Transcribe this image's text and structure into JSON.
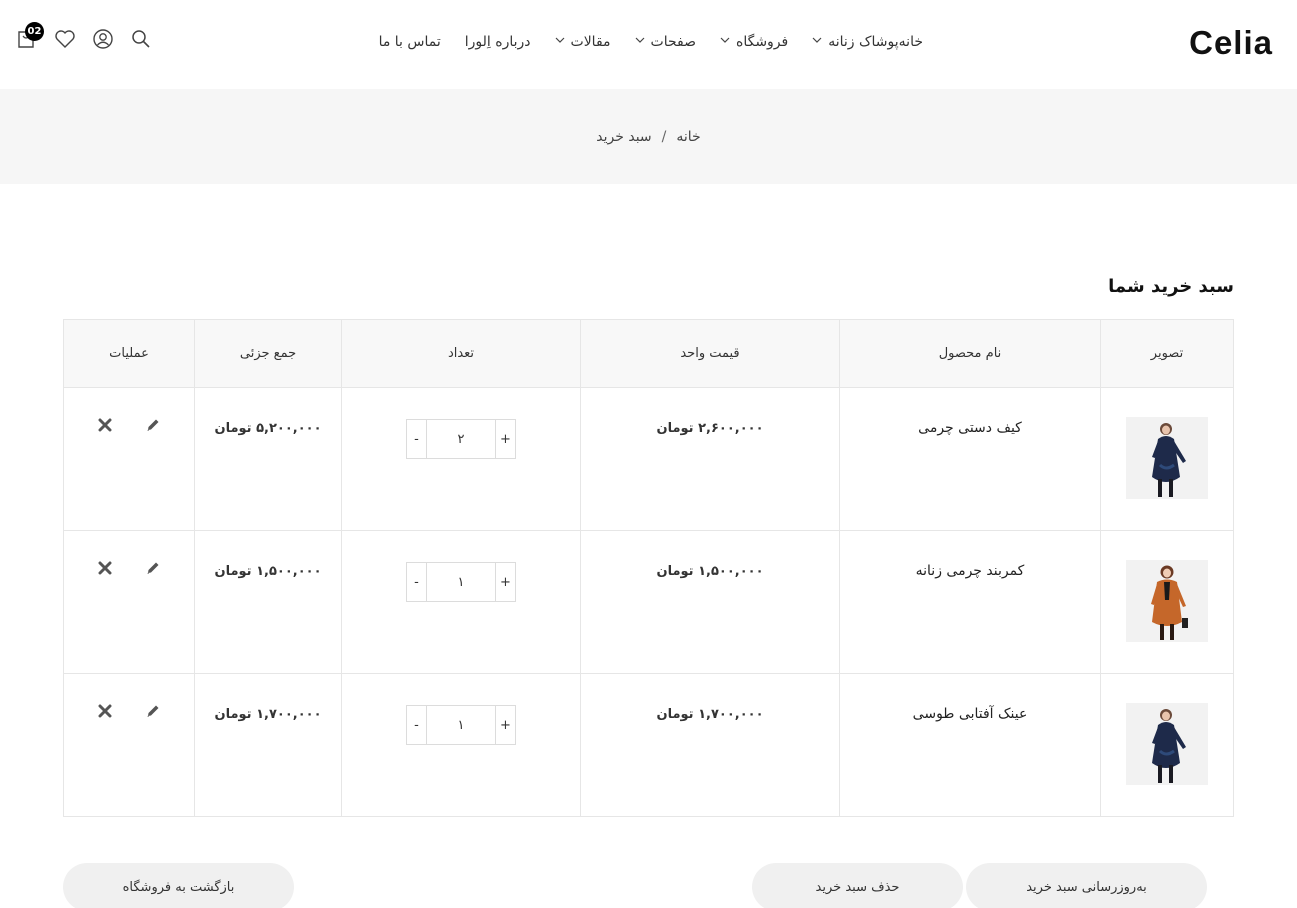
{
  "header": {
    "logo": "Celia",
    "nav": [
      {
        "label": "خانه",
        "has_dropdown": false
      },
      {
        "label": "پوشاک زنانه",
        "has_dropdown": true
      },
      {
        "label": "فروشگاه",
        "has_dropdown": true
      },
      {
        "label": "صفحات",
        "has_dropdown": true
      },
      {
        "label": "مقالات",
        "has_dropdown": true
      },
      {
        "label": "درباره اِلورا",
        "has_dropdown": false
      },
      {
        "label": "تماس با ما",
        "has_dropdown": false
      }
    ],
    "icons": [
      "search-icon",
      "user-icon",
      "heart-icon",
      "cart-icon"
    ],
    "cart_count": "02"
  },
  "breadcrumb": {
    "home": "خانه",
    "separator": "/",
    "current": "سبد خرید"
  },
  "cart": {
    "title": "سبد خرید شما",
    "headers": {
      "image": "تصویر",
      "name": "نام محصول",
      "unit_price": "قیمت واحد",
      "quantity": "تعداد",
      "subtotal": "جمع جزئی",
      "actions": "عملیات"
    },
    "rows": [
      {
        "name": "کیف دستی چرمی",
        "unit_price": "۲,۶۰۰,۰۰۰ تومان",
        "quantity": "۲",
        "subtotal": "۵,۲۰۰,۰۰۰ تومان",
        "image": "navy-coat"
      },
      {
        "name": "کمربند چرمی زنانه",
        "unit_price": "۱,۵۰۰,۰۰۰ تومان",
        "quantity": "۱",
        "subtotal": "۱,۵۰۰,۰۰۰ تومان",
        "image": "orange-coat"
      },
      {
        "name": "عینک آفتابی طوسی",
        "unit_price": "۱,۷۰۰,۰۰۰ تومان",
        "quantity": "۱",
        "subtotal": "۱,۷۰۰,۰۰۰ تومان",
        "image": "navy-coat"
      }
    ],
    "qty_plus": "+",
    "qty_minus": "-"
  },
  "buttons": {
    "update": "به‌روزرسانی سبد خرید",
    "clear": "حذف سبد خرید",
    "back": "بازگشت به فروشگاه"
  },
  "colors": {
    "navy": "#1e2a4a",
    "orange": "#c5672a",
    "crumb_bg": "#f6f6f6",
    "button_bg": "#f0f0f0"
  }
}
